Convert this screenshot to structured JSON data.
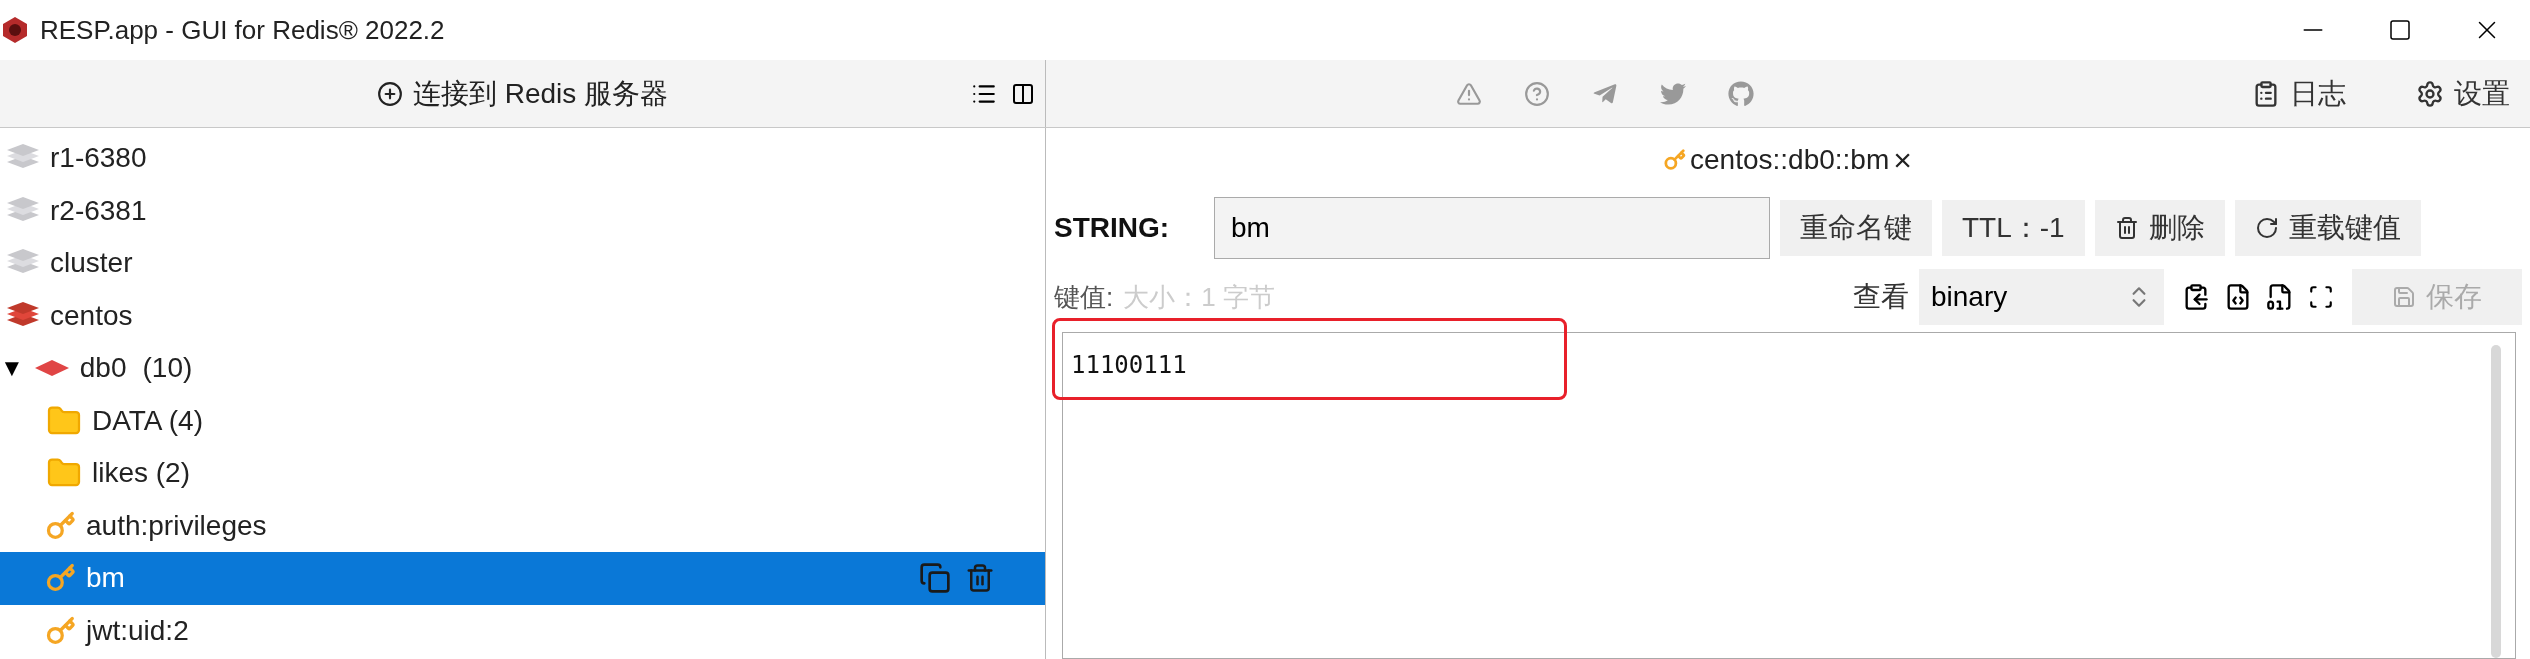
{
  "window": {
    "title": "RESP.app - GUI for Redis® 2022.2"
  },
  "toolbar": {
    "connect_button": "连接到 Redis 服务器",
    "log_button": "日志",
    "settings_button": "设置"
  },
  "tree": [
    {
      "kind": "server",
      "label": "r1-6380",
      "connected": false,
      "selected": false
    },
    {
      "kind": "server",
      "label": "r2-6381",
      "connected": false,
      "selected": false
    },
    {
      "kind": "server",
      "label": "cluster",
      "connected": false,
      "selected": false
    },
    {
      "kind": "server",
      "label": "centos",
      "connected": true,
      "selected": false,
      "children": [
        {
          "kind": "db",
          "label": "db0",
          "count": "(10)",
          "toggle": "▼",
          "expanded": true,
          "selected": false,
          "children": [
            {
              "kind": "folder",
              "label": "DATA (4)",
              "selected": false
            },
            {
              "kind": "folder",
              "label": "likes (2)",
              "selected": false
            },
            {
              "kind": "key",
              "label": "auth:privileges",
              "selected": false
            },
            {
              "kind": "key",
              "label": "bm",
              "selected": true
            },
            {
              "kind": "key",
              "label": "jwt:uid:2",
              "selected": false
            }
          ]
        }
      ]
    }
  ],
  "editor": {
    "tab": {
      "title": "centos::db0::bm",
      "close": "×"
    },
    "type_label": "STRING:",
    "key_name": "bm",
    "rename_button": "重命名键",
    "ttl_button": "TTL：-1",
    "delete_button": "删除",
    "reload_button": "重载键值",
    "value_label": "键值:",
    "size_label": "大小：1 字节",
    "view_label": "查看",
    "view_mode": "binary",
    "save_button": {
      "label": "保存",
      "disabled": true
    },
    "value": "11100111",
    "highlighted": true
  }
}
